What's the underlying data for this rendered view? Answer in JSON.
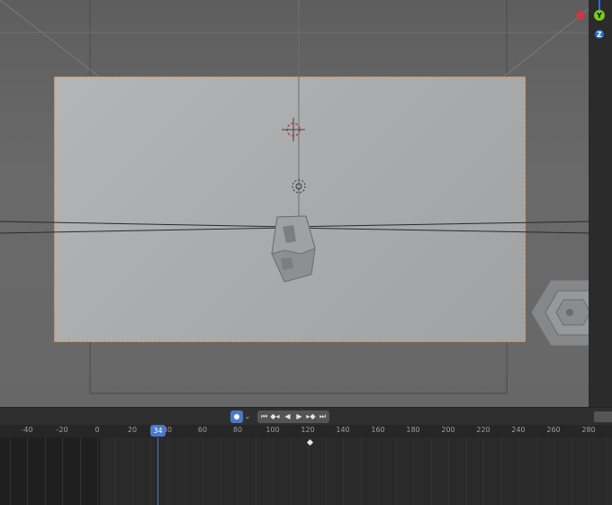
{
  "viewport": {
    "gizmo": {
      "x_label": "",
      "y_label": "Y",
      "z_label": "Z"
    }
  },
  "timeline": {
    "current_frame": "34",
    "auto_keying_chevron": "⌄",
    "playback": {
      "jump_start": "⏮",
      "prev_keyframe": "◆◂",
      "play_reverse": "◀",
      "play": "▶",
      "next_keyframe": "▸◆",
      "jump_end": "⏭"
    },
    "ruler_ticks": [
      {
        "label": "-40"
      },
      {
        "label": "-20"
      },
      {
        "label": "0"
      },
      {
        "label": "20"
      },
      {
        "label": "40"
      },
      {
        "label": "60"
      },
      {
        "label": "80"
      },
      {
        "label": "100"
      },
      {
        "label": "120"
      },
      {
        "label": "140"
      },
      {
        "label": "160"
      },
      {
        "label": "180"
      },
      {
        "label": "200"
      },
      {
        "label": "220"
      },
      {
        "label": "240"
      },
      {
        "label": "260"
      },
      {
        "label": "280"
      }
    ]
  },
  "colors": {
    "accent": "#4a79c7",
    "camera_border": "#e08a3a",
    "axis_x": "#c8394c",
    "axis_y": "#7cc81c",
    "axis_z": "#2a70d2"
  }
}
